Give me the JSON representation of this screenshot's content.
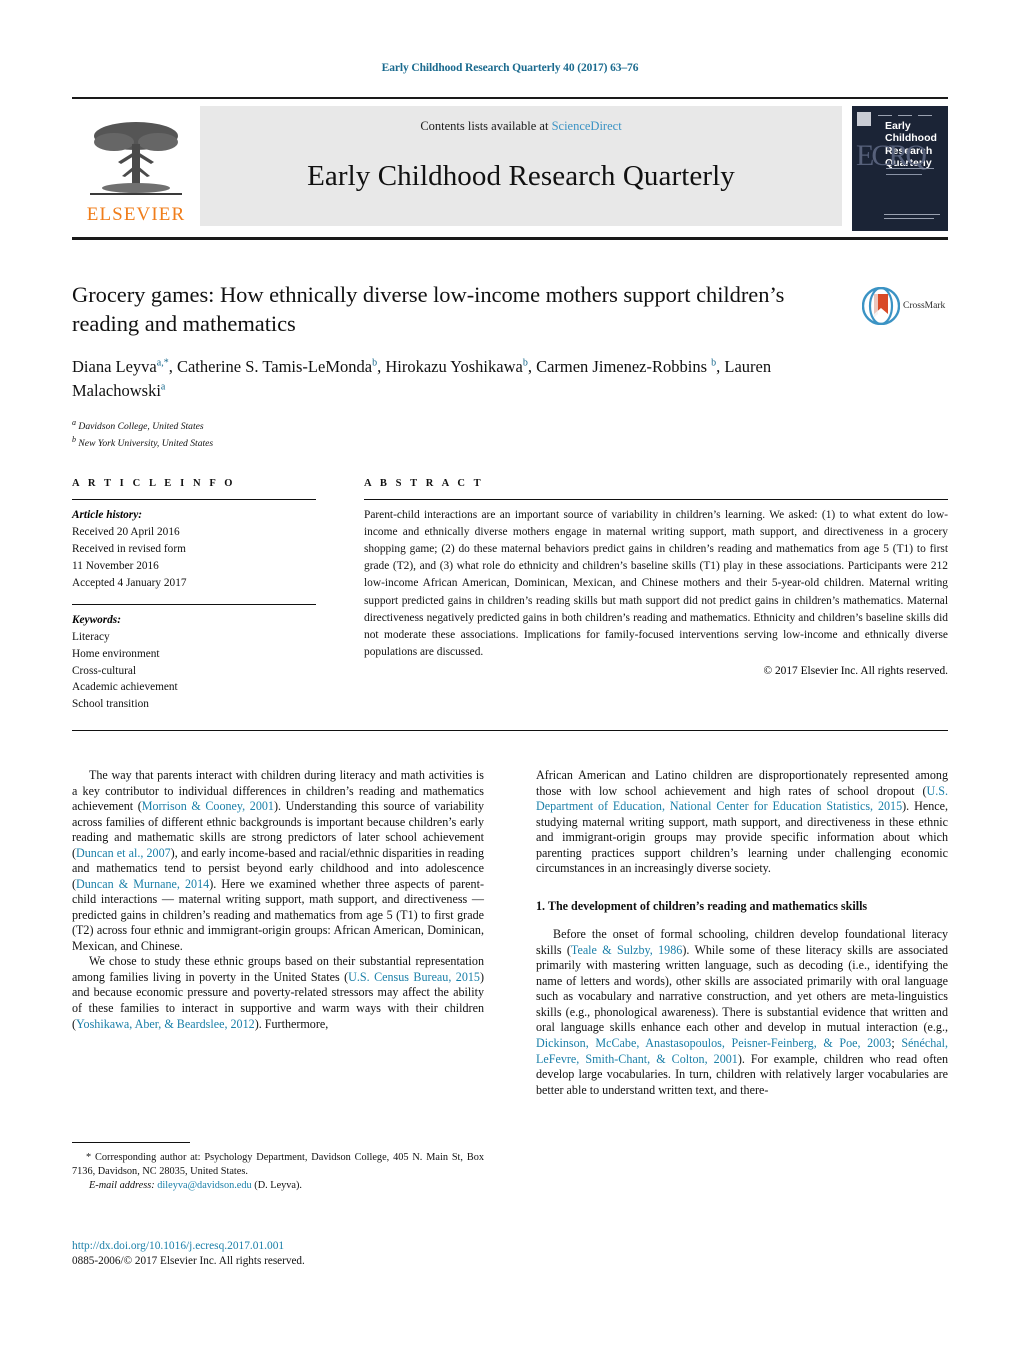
{
  "running_head": "Early Childhood Research Quarterly 40 (2017) 63–76",
  "masthead": {
    "contents_prefix": "Contents lists available at ",
    "sciencedirect": "ScienceDirect",
    "journal_name": "Early Childhood Research Quarterly",
    "publisher_wordmark": "ELSEVIER",
    "cover_title_line1": "Early",
    "cover_title_line2": "Childhood",
    "cover_title_line3": "Research",
    "cover_title_line4": "Quarterly",
    "cover_monogram": "ECRQ",
    "accent_blue": "#1a6a8e",
    "link_blue": "#1a7fa8",
    "sciencedirect_blue": "#3b93c4",
    "elsevier_orange": "#f07d1a"
  },
  "article": {
    "title": "Grocery games: How ethnically diverse low-income mothers support children’s reading and mathematics",
    "authors_html": "Diana Leyva<sup>a,*</sup>, Catherine S. Tamis-LeMonda<sup>b</sup>, Hirokazu Yoshikawa<sup>b</sup>, Carmen Jimenez-Robbins <sup>b</sup>, Lauren Malachowski<sup>a</sup>",
    "affiliations": [
      {
        "marker": "a",
        "text": "Davidson College, United States"
      },
      {
        "marker": "b",
        "text": "New York University, United States"
      }
    ],
    "crossmark_label": "CrossMark"
  },
  "article_info": {
    "heading": "A R T I C L E   I N F O",
    "history_label": "Article history:",
    "history_lines": [
      "Received 20 April 2016",
      "Received in revised form",
      "11 November 2016",
      "Accepted 4 January 2017"
    ],
    "keywords_label": "Keywords:",
    "keywords": [
      "Literacy",
      "Home environment",
      "Cross-cultural",
      "Academic achievement",
      "School transition"
    ]
  },
  "abstract": {
    "heading": "A B S T R A C T",
    "text": "Parent-child interactions are an important source of variability in children’s learning. We asked: (1) to what extent do low-income and ethnically diverse mothers engage in maternal writing support, math support, and directiveness in a grocery shopping game; (2) do these maternal behaviors predict gains in children’s reading and mathematics from age 5 (T1) to first grade (T2), and (3) what role do ethnicity and children’s baseline skills (T1) play in these associations. Participants were 212 low-income African American, Dominican, Mexican, and Chinese mothers and their 5-year-old children. Maternal writing support predicted gains in children’s reading skills but math support did not predict gains in children’s mathematics. Maternal directiveness negatively predicted gains in both children’s reading and mathematics. Ethnicity and children’s baseline skills did not moderate these associations. Implications for family-focused interventions serving low-income and ethnically diverse populations are discussed.",
    "copyright": "© 2017 Elsevier Inc. All rights reserved."
  },
  "body": {
    "left_para1": {
      "s1": "The way that parents interact with children during literacy and math activities is a key contributor to individual differences in children’s reading and mathematics achievement (",
      "r1": "Morrison & Cooney, 2001",
      "s2": "). Understanding this source of variability across families of different ethnic backgrounds is important because children’s early reading and mathematic skills are strong predictors of later school achievement (",
      "r2": "Duncan et al., 2007",
      "s3": "), and early income-based and racial/ethnic disparities in reading and mathematics tend to persist beyond early childhood and into adolescence (",
      "r3": "Duncan & Murnane, 2014",
      "s4": "). Here we examined whether three aspects of parent-child interactions — maternal writing support, math support, and directiveness — predicted gains in children’s reading and mathematics from age 5 (T1) to first grade (T2) across four ethnic and immigrant-origin groups: African American, Dominican, Mexican, and Chinese."
    },
    "left_para2": {
      "s1": "We chose to study these ethnic groups based on their substantial representation among families living in poverty in the United States (",
      "r1": "U.S. Census Bureau, 2015",
      "s2": ") and because economic pressure and poverty-related stressors may affect the ability of these families to interact in supportive and warm ways with their children (",
      "r2": "Yoshikawa, Aber, & Beardslee, 2012",
      "s3": "). Furthermore,"
    },
    "right_para1": {
      "s1": "African American and Latino children are disproportionately represented among those with low school achievement and high rates of school dropout (",
      "r1": "U.S. Department of Education, National Center for Education Statistics, 2015",
      "s2": "). Hence, studying maternal writing support, math support, and directiveness in these ethnic and immigrant-origin groups may provide specific information about which parenting practices support children’s learning under challenging economic circumstances in an increasingly diverse society."
    },
    "section1_heading": "1. The development of children’s reading and mathematics skills",
    "right_para2": {
      "s1": "Before the onset of formal schooling, children develop foundational literacy skills (",
      "r1": "Teale & Sulzby, 1986",
      "s2": "). While some of these literacy skills are associated primarily with mastering written language, such as decoding (i.e., identifying the name of letters and words), other skills are associated primarily with oral language such as vocabulary and narrative construction, and yet others are meta-linguistics skills (e.g., phonological awareness). There is substantial evidence that written and oral language skills enhance each other and develop in mutual interaction (e.g., ",
      "r2": "Dickinson, McCabe, Anastasopoulos, Peisner-Feinberg, & Poe, 2003",
      "s3": "; ",
      "r3": "Sénéchal, LeFevre, Smith-Chant, & Colton, 2001",
      "s4": "). For example, children who read often develop large vocabularies. In turn, children with relatively larger vocabularies are better able to understand written text, and there-"
    }
  },
  "footer": {
    "corresponding_marker": "*",
    "corresponding_text": "Corresponding author at: Psychology Department, Davidson College, 405 N. Main St, Box 7136, Davidson, NC 28035, United States.",
    "email_label": "E-mail address:",
    "email_value": "dileyva@davidson.edu",
    "email_suffix": "(D. Leyva).",
    "doi": "http://dx.doi.org/10.1016/j.ecresq.2017.01.001",
    "issn_line": "0885-2006/© 2017 Elsevier Inc. All rights reserved."
  }
}
